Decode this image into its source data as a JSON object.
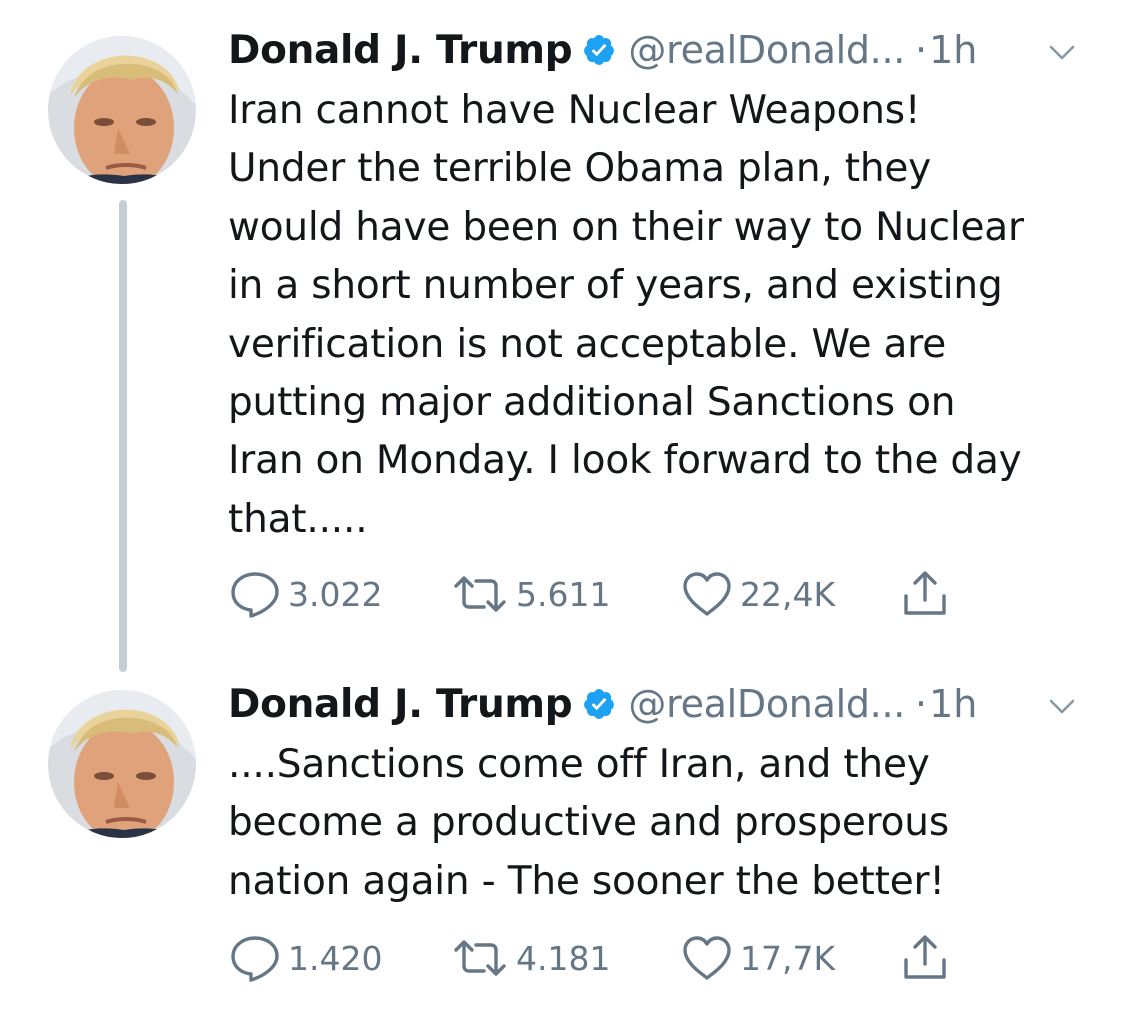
{
  "thread": {
    "tweets": [
      {
        "author_name": "Donald J. Trump",
        "handle": "@realDonald...",
        "separator": "·",
        "time": "1h",
        "text_lines": [
          "Iran cannot have Nuclear Weapons!",
          "Under the terrible Obama plan, they",
          "would have been on their way to Nuclear",
          "in a short number of years, and existing",
          "verification is not acceptable. We are",
          "putting major additional Sanctions on",
          "Iran on Monday. I look forward to the day",
          "that....."
        ],
        "replies": "3.022",
        "retweets": "5.611",
        "likes": "22,4K"
      },
      {
        "author_name": "Donald J. Trump",
        "handle": "@realDonald...",
        "separator": "·",
        "time": "1h",
        "text_lines": [
          "....Sanctions come off Iran, and they",
          "become a productive and prosperous",
          "nation again - The sooner the better!"
        ],
        "replies": "1.420",
        "retweets": "4.181",
        "likes": "17,7K"
      }
    ]
  },
  "icons": {
    "verified": "verified-badge-icon",
    "caret": "chevron-down-icon",
    "reply": "reply-icon",
    "retweet": "retweet-icon",
    "like": "heart-icon",
    "share": "share-icon"
  },
  "colors": {
    "text": "#14171a",
    "secondary": "#657786",
    "verified_blue": "#1da1f2",
    "thread_line": "#c4cfd6"
  }
}
